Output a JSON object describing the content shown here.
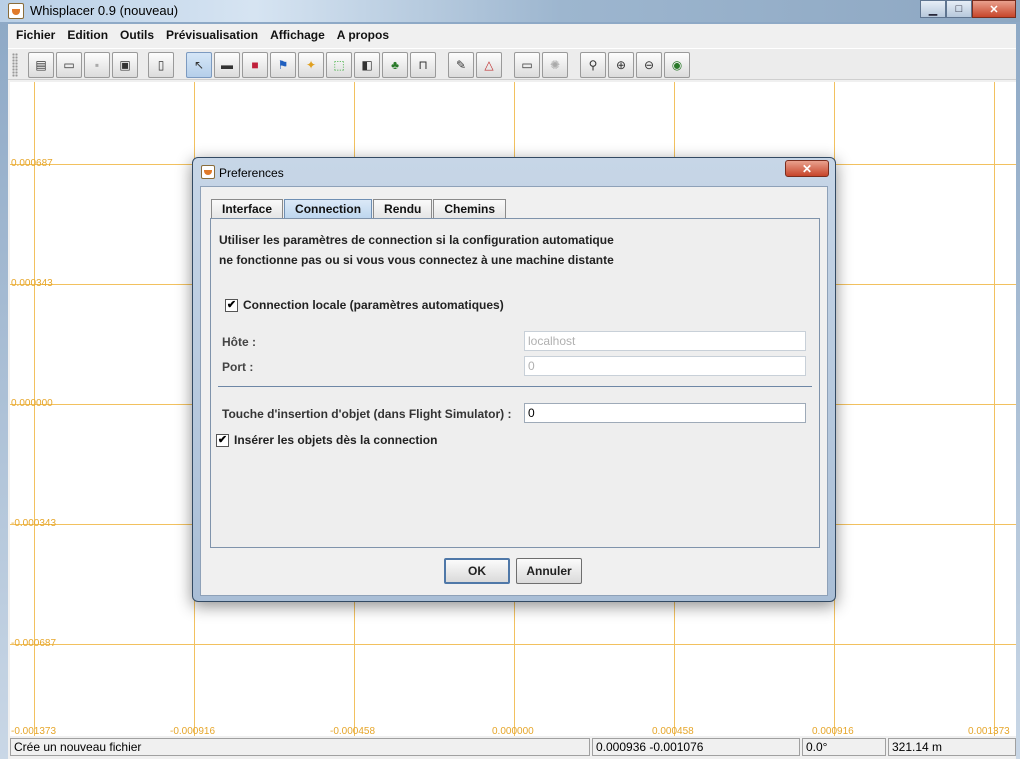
{
  "window": {
    "title": "Whisplacer 0.9 (nouveau)",
    "btn_min": "▁",
    "btn_max": "□",
    "btn_close": "✕"
  },
  "menu": [
    "Fichier",
    "Edition",
    "Outils",
    "Prévisualisation",
    "Affichage",
    "A propos"
  ],
  "toolbar": {
    "icons": [
      "new-file-icon",
      "open-icon",
      "save-icon",
      "save-as-icon",
      "properties-icon",
      "select-tool-icon",
      "runway-icon",
      "building-icon",
      "flag-icon",
      "light-icon",
      "area-icon",
      "fuel-icon",
      "tree-icon",
      "hangar-icon",
      "edit-tool-icon",
      "polygon-tool-icon",
      "preview-icon",
      "terrain-icon",
      "zoom-icon",
      "zoom-in-icon",
      "zoom-out-icon",
      "zoom-fit-icon"
    ],
    "selected_icon": "select-tool-icon"
  },
  "canvas": {
    "y_labels": [
      "0.000687",
      "0.000343",
      "0.000000",
      "-0.000343",
      "-0.000687"
    ],
    "x_labels": [
      "-0.001373",
      "-0.000916",
      "-0.000458",
      "0.000000",
      "0.000458",
      "0.000916",
      "0.001373"
    ],
    "grid_color": "#f2c15f",
    "label_color": "#e6a62a"
  },
  "status": {
    "message": "Crée un nouveau fichier",
    "coords": "0.000936 -0.001076",
    "angle": "0.0°",
    "distance": "321.14 m"
  },
  "dialog": {
    "title": "Preferences",
    "close": "✕",
    "tabs": [
      "Interface",
      "Connection",
      "Rendu",
      "Chemins"
    ],
    "active_tab": "Connection",
    "desc_line1": "Utiliser les paramètres de connection si la configuration automatique",
    "desc_line2": "ne fonctionne pas ou si vous vous connectez à une machine distante",
    "local_checkbox": {
      "label": "Connection locale (paramètres automatiques)",
      "checked": true,
      "mark": "✔"
    },
    "host": {
      "label": "Hôte :",
      "value": "localhost"
    },
    "port": {
      "label": "Port :",
      "value": "0"
    },
    "insert_key": {
      "label": "Touche d'insertion d'objet (dans Flight Simulator) :",
      "value": "0"
    },
    "insert_checkbox": {
      "label": "Insérer les objets dès la connection",
      "checked": true,
      "mark": "✔"
    },
    "ok_label": "OK",
    "cancel_label": "Annuler"
  }
}
